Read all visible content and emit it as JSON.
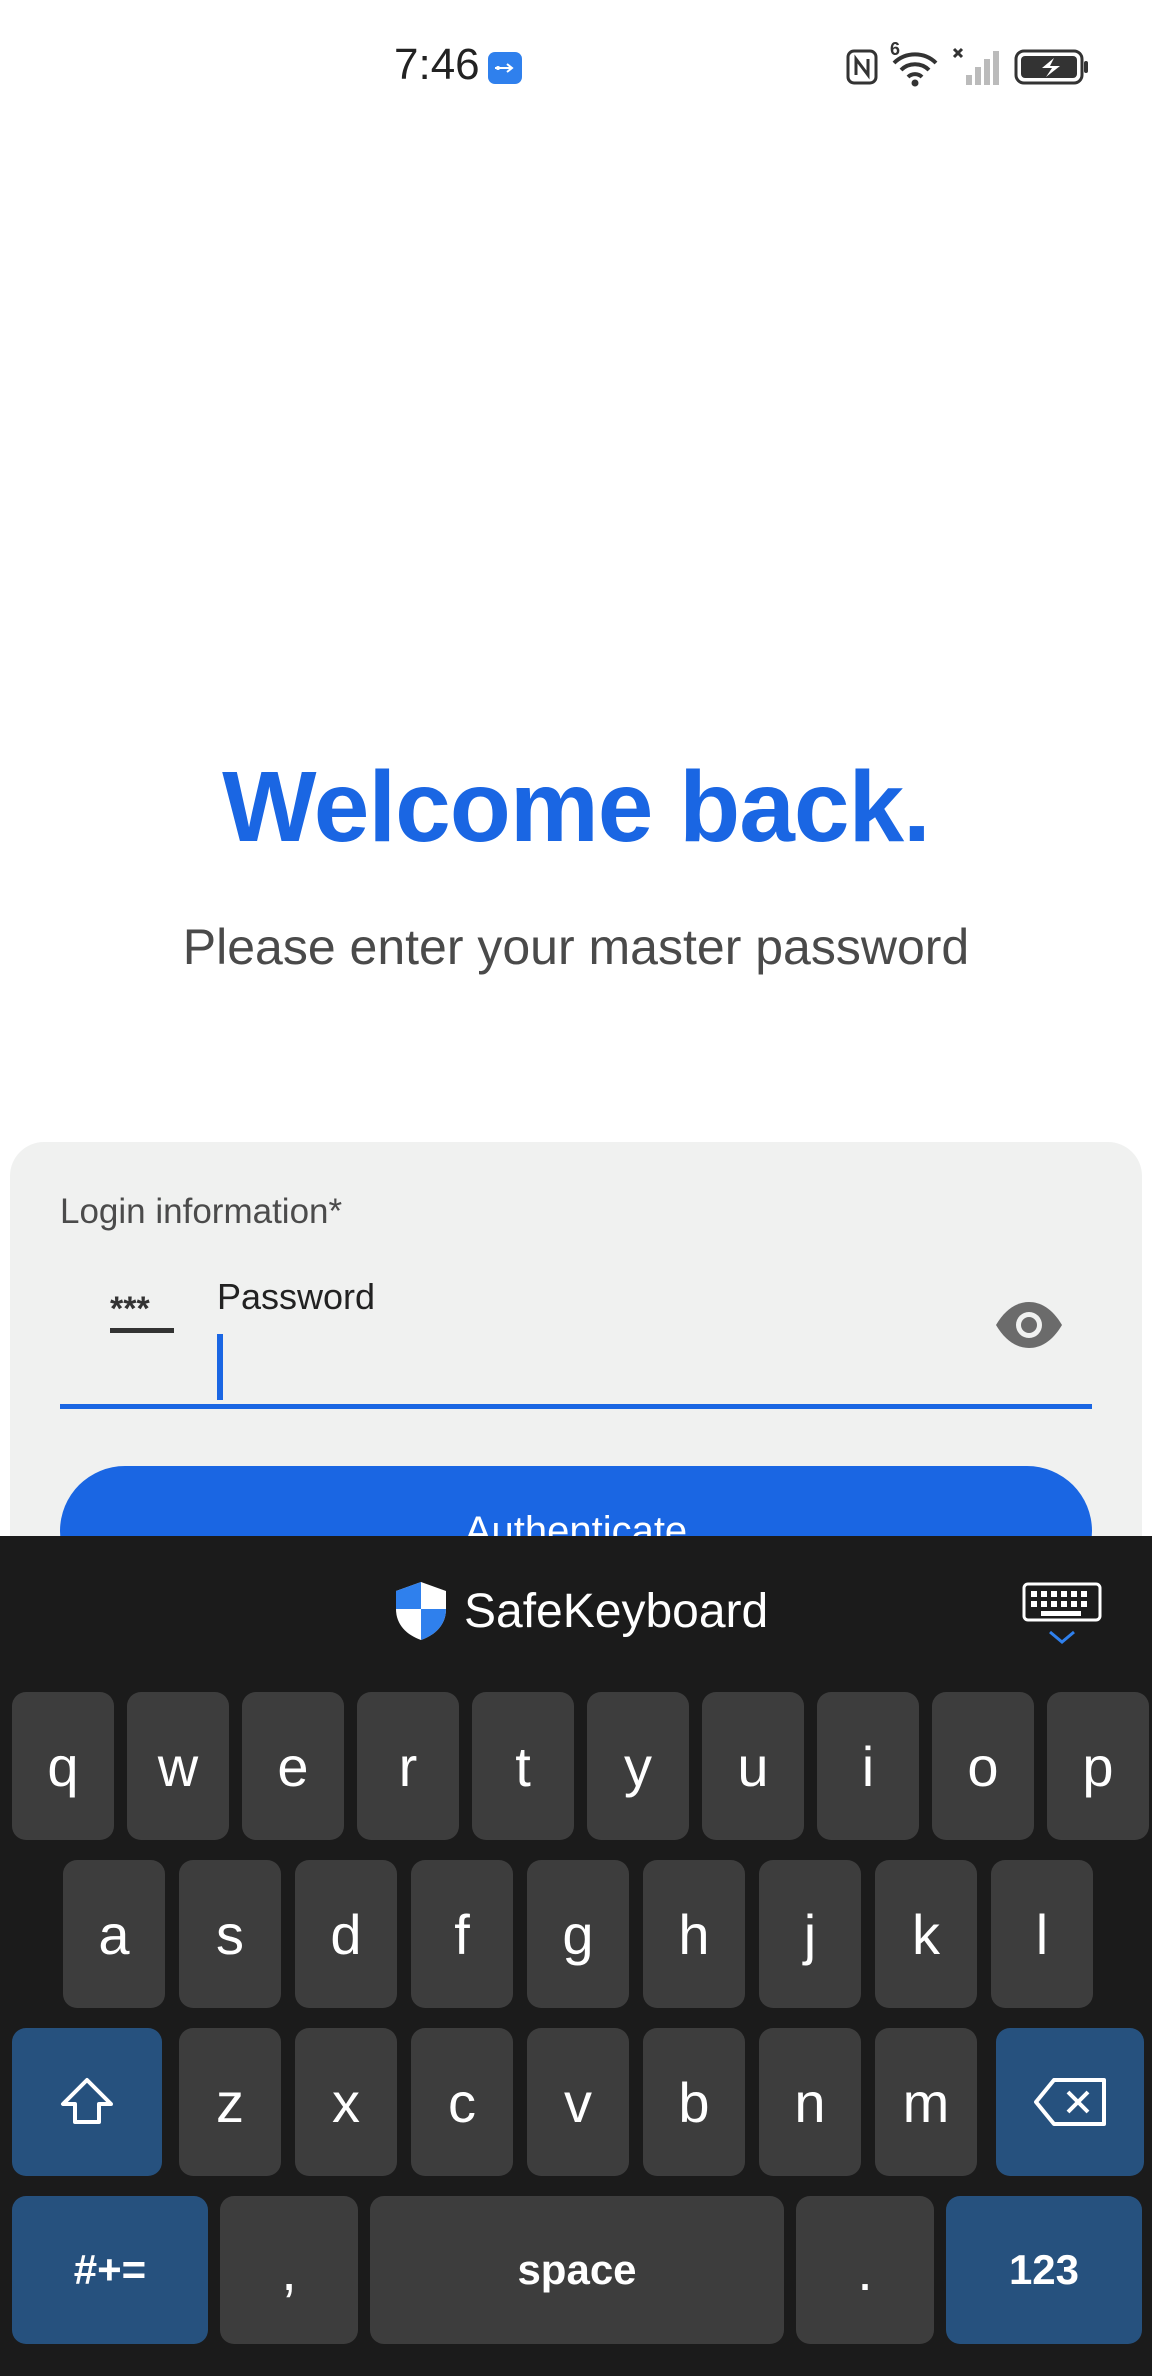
{
  "status_bar": {
    "time": "7:46",
    "icons": [
      "usb-icon",
      "nfc-icon",
      "wifi-icon",
      "signal-icon",
      "battery-charging-icon"
    ],
    "wifi_badge": "6"
  },
  "hero": {
    "title": "Welcome back.",
    "subtitle": "Please enter your master password"
  },
  "login_card": {
    "label": "Login information*",
    "password": {
      "label": "Password",
      "value": "",
      "icon": "password-stars-icon",
      "toggle_icon": "eye-icon"
    },
    "auth_button": "Authenticate"
  },
  "keyboard": {
    "brand": "SafeKeyboard",
    "row1": [
      "q",
      "w",
      "e",
      "r",
      "t",
      "y",
      "u",
      "i",
      "o",
      "p"
    ],
    "row2": [
      "a",
      "s",
      "d",
      "f",
      "g",
      "h",
      "j",
      "k",
      "l"
    ],
    "row3": [
      "z",
      "x",
      "c",
      "v",
      "b",
      "n",
      "m"
    ],
    "symbols_key": "#+=",
    "comma_key": ",",
    "space_key": "space",
    "period_key": ".",
    "numbers_key": "123"
  },
  "colors": {
    "accent": "#1a66e3",
    "keyboard_bg": "#1b1b1b",
    "key_bg": "#3d3d3d",
    "function_key_bg": "#26517e",
    "card_bg": "#f0f1f0"
  }
}
